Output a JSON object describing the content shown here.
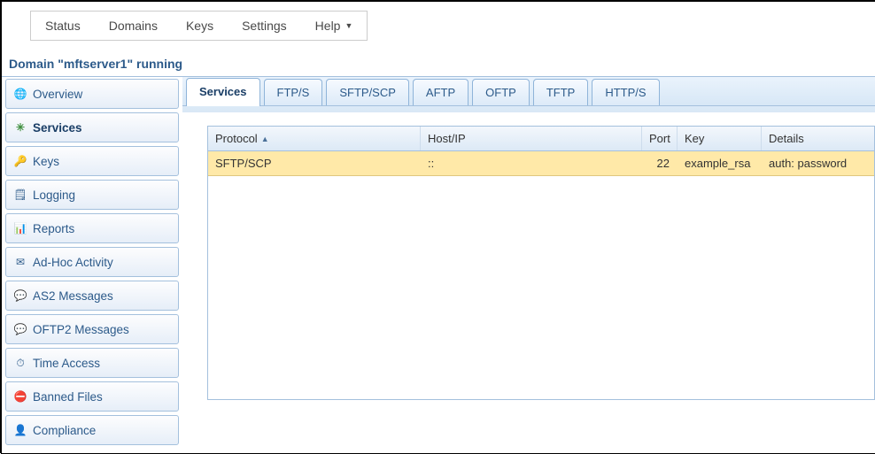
{
  "topnav": {
    "status": "Status",
    "domains": "Domains",
    "keys": "Keys",
    "settings": "Settings",
    "help": "Help"
  },
  "page_title": "Domain \"mftserver1\" running",
  "sidebar": {
    "items": [
      {
        "label": "Overview"
      },
      {
        "label": "Services"
      },
      {
        "label": "Keys"
      },
      {
        "label": "Logging"
      },
      {
        "label": "Reports"
      },
      {
        "label": "Ad-Hoc Activity"
      },
      {
        "label": "AS2 Messages"
      },
      {
        "label": "OFTP2 Messages"
      },
      {
        "label": "Time Access"
      },
      {
        "label": "Banned Files"
      },
      {
        "label": "Compliance"
      }
    ]
  },
  "tabs": [
    {
      "label": "Services"
    },
    {
      "label": "FTP/S"
    },
    {
      "label": "SFTP/SCP"
    },
    {
      "label": "AFTP"
    },
    {
      "label": "OFTP"
    },
    {
      "label": "TFTP"
    },
    {
      "label": "HTTP/S"
    }
  ],
  "table": {
    "headers": {
      "protocol": "Protocol",
      "host": "Host/IP",
      "port": "Port",
      "key": "Key",
      "details": "Details"
    },
    "rows": [
      {
        "protocol": "SFTP/SCP",
        "host": "::",
        "port": "22",
        "key": "example_rsa",
        "details": "auth: password"
      }
    ]
  }
}
